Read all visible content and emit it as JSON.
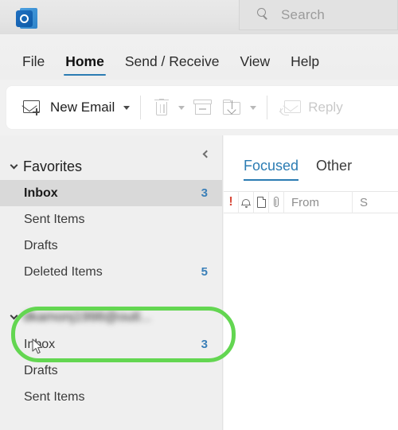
{
  "app": {
    "logo_icon": "outlook-logo-icon"
  },
  "search": {
    "placeholder": "Search",
    "icon": "search-icon"
  },
  "menubar": {
    "items": [
      {
        "label": "File",
        "active": false
      },
      {
        "label": "Home",
        "active": true
      },
      {
        "label": "Send / Receive",
        "active": false
      },
      {
        "label": "View",
        "active": false
      },
      {
        "label": "Help",
        "active": false
      }
    ]
  },
  "ribbon": {
    "new_email_label": "New Email",
    "new_email_icon": "new-email-icon",
    "new_email_caret": "chevron-down-icon",
    "delete_icon": "trash-icon",
    "delete_caret": "chevron-down-icon",
    "archive_icon": "archive-icon",
    "move_icon": "move-to-folder-icon",
    "move_caret": "chevron-down-icon",
    "reply_icon": "reply-icon",
    "reply_label": "Reply"
  },
  "navpane": {
    "collapse_icon": "chevron-left-icon",
    "favorites": {
      "expand_icon": "chevron-down-icon",
      "label": "Favorites",
      "folders": [
        {
          "name": "Inbox",
          "count": "3",
          "selected": true
        },
        {
          "name": "Sent Items",
          "count": "",
          "selected": false
        },
        {
          "name": "Drafts",
          "count": "",
          "selected": false
        },
        {
          "name": "Deleted Items",
          "count": "5",
          "selected": false
        }
      ]
    },
    "account": {
      "expand_icon": "chevron-down-icon",
      "name": "dkamonj1998@outl...",
      "folders": [
        {
          "name": "Inbox",
          "count": "3",
          "selected": false
        },
        {
          "name": "Drafts",
          "count": "",
          "selected": false
        },
        {
          "name": "Sent Items",
          "count": "",
          "selected": false
        }
      ]
    }
  },
  "highlight": {
    "color": "#63d651",
    "target": "account-header-row"
  },
  "messagelist": {
    "tabs": [
      {
        "label": "Focused",
        "active": true
      },
      {
        "label": "Other",
        "active": false
      }
    ],
    "columns": [
      {
        "type": "icon",
        "icon": "importance-icon",
        "glyph": "!",
        "label": ""
      },
      {
        "type": "icon",
        "icon": "reminder-bell-icon",
        "label": ""
      },
      {
        "type": "icon",
        "icon": "document-icon",
        "label": ""
      },
      {
        "type": "icon",
        "icon": "attachment-clip-icon",
        "label": ""
      },
      {
        "type": "text",
        "label": "From"
      },
      {
        "type": "text",
        "label": "S"
      }
    ]
  },
  "colors": {
    "accent_blue": "#2b7cb3",
    "count_blue": "#3a7fb8",
    "highlight_green": "#63d651",
    "selected_row": "#d9d9d9"
  }
}
